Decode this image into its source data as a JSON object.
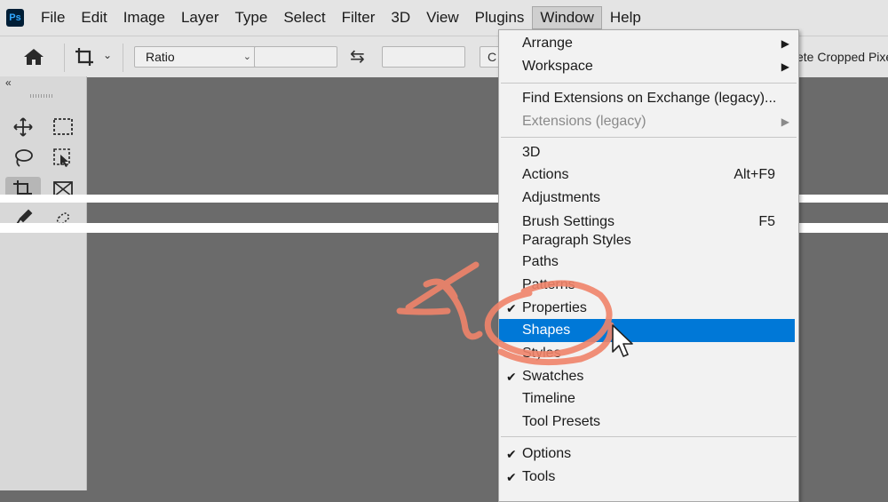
{
  "app": {
    "logo_text": "Ps"
  },
  "menubar": {
    "items": [
      "File",
      "Edit",
      "Image",
      "Layer",
      "Type",
      "Select",
      "Filter",
      "3D",
      "View",
      "Plugins",
      "Window",
      "Help"
    ],
    "active": "Window"
  },
  "options_bar": {
    "ratio_label": "Ratio",
    "width_value": "",
    "height_value": "",
    "clear_label": "C",
    "delete_cropped_label": "ete Cropped Pixel"
  },
  "tools_panel": {
    "collapse_glyph": "«",
    "tools": [
      {
        "name": "move-tool",
        "icon": "move-icon"
      },
      {
        "name": "marquee-tool",
        "icon": "rect-marquee-icon"
      },
      {
        "name": "lasso-tool",
        "icon": "lasso-icon"
      },
      {
        "name": "object-select-tool",
        "icon": "object-select-icon"
      },
      {
        "name": "crop-tool",
        "icon": "crop-icon",
        "selected": true
      },
      {
        "name": "frame-tool",
        "icon": "frame-icon"
      },
      {
        "name": "eyedropper-tool",
        "icon": "eyedropper-icon"
      },
      {
        "name": "healing-tool",
        "icon": "healing-icon"
      }
    ]
  },
  "window_menu": {
    "items": [
      {
        "label": "Arrange",
        "submenu": true
      },
      {
        "label": "Workspace",
        "submenu": true
      },
      {
        "label": "Find Extensions on Exchange (legacy)..."
      },
      {
        "label": "Extensions (legacy)",
        "submenu": true,
        "disabled": true
      },
      {
        "label": "3D"
      },
      {
        "label": "Actions",
        "shortcut": "Alt+F9"
      },
      {
        "label": "Adjustments"
      },
      {
        "label": "Brush Settings",
        "shortcut": "F5"
      },
      {
        "label": "Paragraph Styles"
      },
      {
        "label": "Paths"
      },
      {
        "label": "Patterns"
      },
      {
        "label": "Properties",
        "checked": true
      },
      {
        "label": "Shapes",
        "highlighted": true
      },
      {
        "label": "Styles"
      },
      {
        "label": "Swatches",
        "checked": true
      },
      {
        "label": "Timeline"
      },
      {
        "label": "Tool Presets"
      },
      {
        "label": "Options",
        "checked": true
      },
      {
        "label": "Tools",
        "checked": true
      }
    ]
  },
  "colors": {
    "highlight": "#0078d7",
    "annotation": "#f0846a",
    "canvas": "#6b6b6b",
    "chrome": "#e4e4e4"
  }
}
